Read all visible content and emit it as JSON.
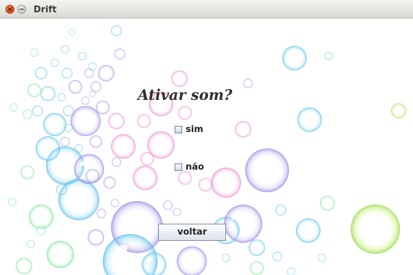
{
  "window": {
    "title": "Drift",
    "close_icon": "close-icon",
    "minimize_icon": "minimize-icon"
  },
  "main": {
    "heading": "Ativar som?",
    "options": [
      {
        "label": "sim",
        "checked": false
      },
      {
        "label": "não",
        "checked": false
      }
    ],
    "back_button": "voltar"
  },
  "colors": {
    "close_button": "#df4b16",
    "bubble_palette": [
      "#7fd3f0",
      "#b7a8f0",
      "#f4a6d9",
      "#9ff0b4",
      "#c7f06e"
    ]
  }
}
